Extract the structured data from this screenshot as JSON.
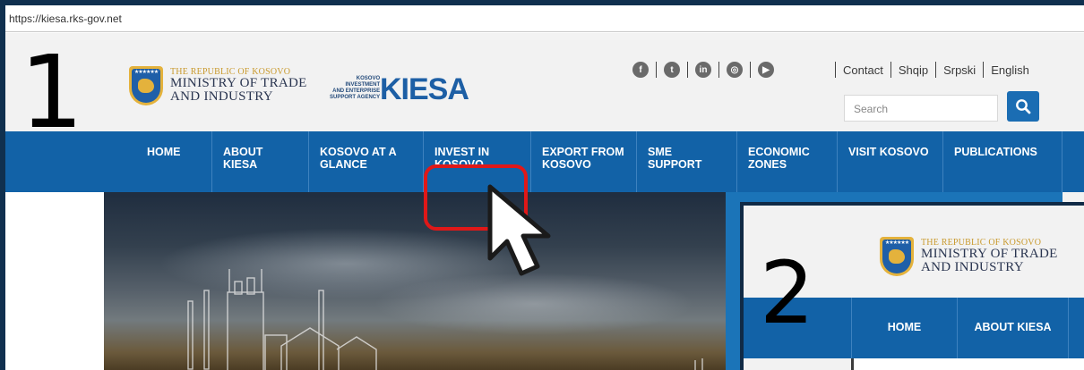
{
  "browser": {
    "url": "https://kiesa.rks-gov.net"
  },
  "header": {
    "ministry_line1": "THE REPUBLIC OF KOSOVO",
    "ministry_line2": "MINISTRY OF TRADE",
    "ministry_line3": "AND INDUSTRY",
    "kiesa_small": [
      "KOSOVO",
      "INVESTMENT",
      "AND ENTERPRISE",
      "SUPPORT AGENCY"
    ],
    "kiesa_logo": "KIESA",
    "social_icons": [
      "facebook-icon",
      "twitter-icon",
      "linkedin-icon",
      "instagram-icon",
      "youtube-icon"
    ],
    "links": [
      "Contact",
      "Shqip",
      "Srpski",
      "English"
    ],
    "search_placeholder": "Search"
  },
  "nav": [
    {
      "label1": "HOME",
      "label2": ""
    },
    {
      "label1": "ABOUT KIESA",
      "label2": ""
    },
    {
      "label1": "KOSOVO AT A",
      "label2": "GLANCE"
    },
    {
      "label1": "INVEST IN",
      "label2": "KOSOVO"
    },
    {
      "label1": "EXPORT FROM",
      "label2": "KOSOVO"
    },
    {
      "label1": "SME SUPPORT",
      "label2": ""
    },
    {
      "label1": "ECONOMIC",
      "label2": "ZONES"
    },
    {
      "label1": "VISIT KOSOVO",
      "label2": ""
    },
    {
      "label1": "PUBLICATIONS",
      "label2": ""
    }
  ],
  "annotations": {
    "step1": "1",
    "step2": "2"
  },
  "zoom": {
    "ministry_line1": "THE REPUBLIC OF KOSOVO",
    "ministry_line2": "MINISTRY OF TRADE",
    "ministry_line3": "AND INDUSTRY",
    "nav": [
      "HOME",
      "ABOUT KIESA"
    ]
  },
  "colors": {
    "nav_blue": "#1262a7",
    "highlight_red": "#e01818",
    "search_blue": "#1b6db3",
    "frame_navy": "#10304f"
  }
}
